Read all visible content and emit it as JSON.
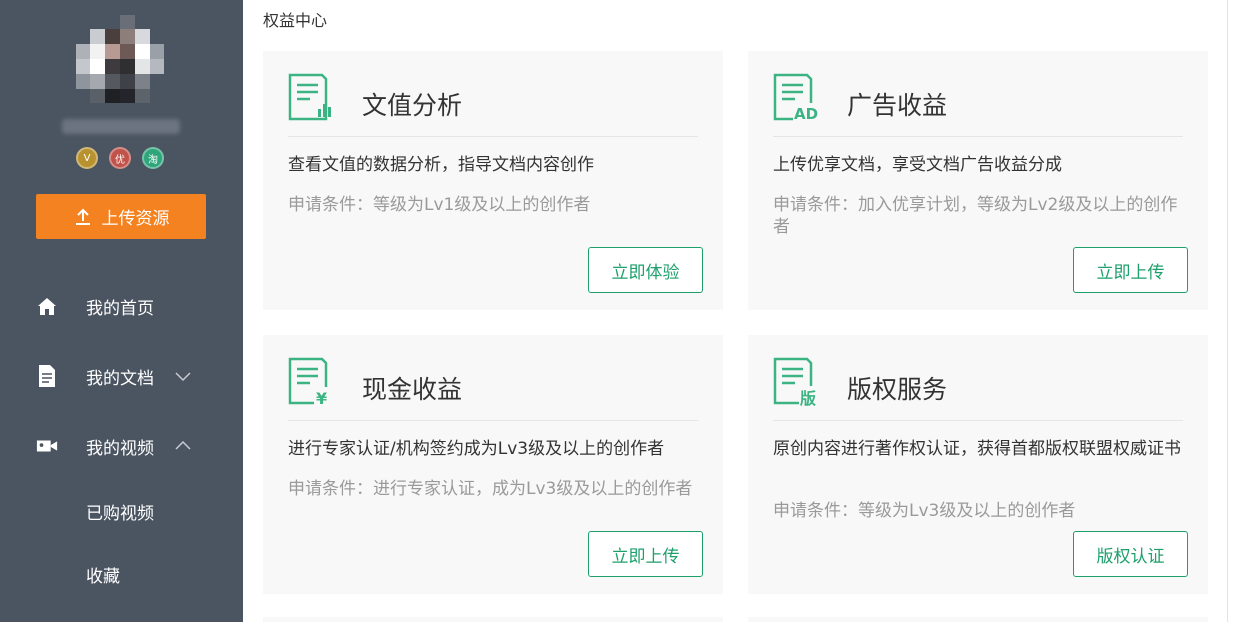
{
  "sidebar": {
    "badges": [
      "V",
      "优",
      "淘"
    ],
    "upload_label": "上传资源",
    "nav": {
      "home": "我的首页",
      "docs": "我的文档",
      "videos": "我的视频",
      "purchased_videos": "已购视频",
      "favorites": "收藏"
    }
  },
  "main": {
    "title": "权益中心",
    "cards": [
      {
        "title": "文值分析",
        "desc": "查看文值的数据分析，指导文档内容创作",
        "condition": "申请条件：等级为Lv1级及以上的创作者",
        "button": "立即体验",
        "icon": "doc-chart-icon"
      },
      {
        "title": "广告收益",
        "desc": "上传优享文档，享受文档广告收益分成",
        "condition": "申请条件：加入优享计划，等级为Lv2级及以上的创作者",
        "button": "立即上传",
        "icon": "doc-ad-icon",
        "icon_text": "AD"
      },
      {
        "title": "现金收益",
        "desc": "进行专家认证/机构签约成为Lv3级及以上的创作者",
        "condition": "申请条件：进行专家认证，成为Lv3级及以上的创作者",
        "button": "立即上传",
        "icon": "doc-yuan-icon",
        "icon_text": "¥"
      },
      {
        "title": "版权服务",
        "desc": "原创内容进行著作权认证，获得首都版权联盟权威证书",
        "condition": "申请条件：等级为Lv3级及以上的创作者",
        "button": "版权认证",
        "icon": "doc-copyright-icon",
        "icon_text": "版"
      }
    ]
  },
  "colors": {
    "sidebar_bg": "#4b5461",
    "accent_orange": "#f58220",
    "accent_green": "#1ea06c",
    "card_bg": "#f8f8f8"
  }
}
